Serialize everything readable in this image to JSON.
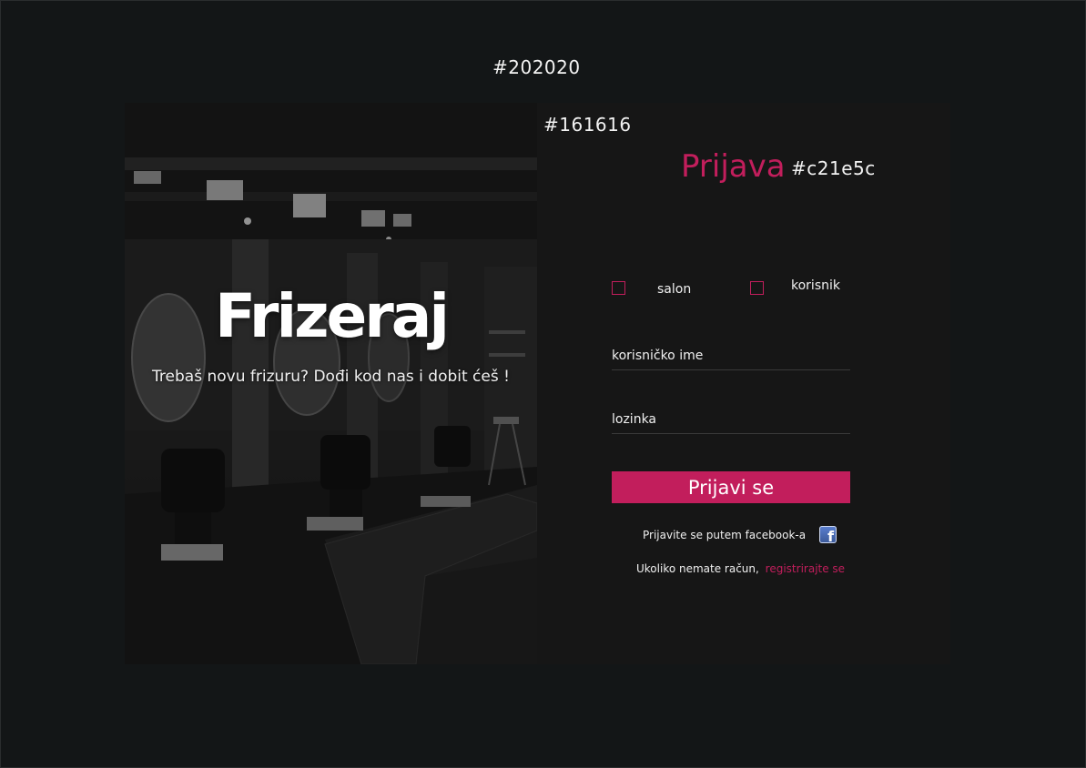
{
  "annotations": {
    "background_color_label": "#202020",
    "panel_color_label": "#161616",
    "accent_color_label": "#c21e5c"
  },
  "colors": {
    "background": "#202020",
    "panel": "#161616",
    "accent": "#c21e5c"
  },
  "hero": {
    "title": "Frizeraj",
    "subtitle": "Trebaš novu frizuru? Dođi kod nas i dobit ćeš !",
    "image": "salon-interior-photo"
  },
  "login": {
    "title": "Prijava",
    "account_types": [
      {
        "label": "salon",
        "checked": false
      },
      {
        "label": "korisnik",
        "checked": false
      }
    ],
    "username_placeholder": "korisničko ime",
    "password_placeholder": "lozinka",
    "submit_label": "Prijavi se",
    "facebook_text": "Prijavite se putem facebook-a",
    "facebook_icon": "facebook-icon",
    "register_prompt": "Ukoliko nemate račun,",
    "register_link": "registrirajte se"
  }
}
